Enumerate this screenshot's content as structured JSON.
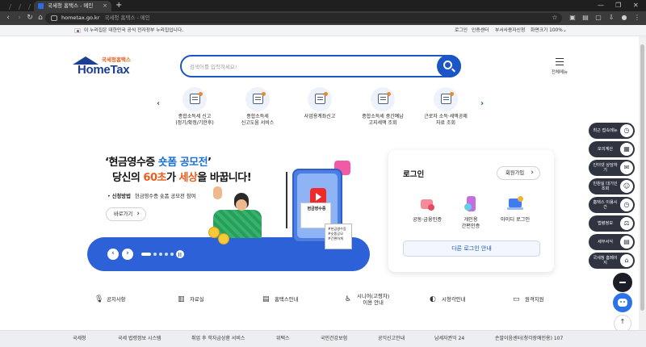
{
  "browser": {
    "tab_title": "국세청 홈택스 - 메인",
    "tab_close": "×",
    "new_tab": "+",
    "url_host": "hometax.go.kr",
    "url_title": "국세청 홈택스 - 메인",
    "window_min": "—",
    "window_max": "❐",
    "window_close": "✕"
  },
  "govbar": {
    "notice": "이 누리집은 대한민국 공식 전자정부 누리집입니다.",
    "links": [
      "로그인",
      "인증센터",
      "부서사용자신청"
    ],
    "zoom": "화면크기 100%"
  },
  "header": {
    "logo_sub": "국세청홈택스",
    "logo_main": "HomeTax",
    "search_placeholder": "검색어를 입력하세요!",
    "all_menu_label": "전체메뉴"
  },
  "quick_menu": [
    {
      "line1": "종합소득세 신고",
      "line2": "(정기/확정/기한후)"
    },
    {
      "line1": "종합소득세",
      "line2": "신고도움 서비스"
    },
    {
      "line1": "사업용계좌신고",
      "line2": ""
    },
    {
      "line1": "종합소득세 중간예납",
      "line2": "고지세액 조회"
    },
    {
      "line1": "근로자 소득·세액공제",
      "line2": "자료 조회"
    }
  ],
  "banner": {
    "headline_open": "‘현금영수증 ",
    "headline_accent": "숏폼 공모전",
    "headline_close": "’",
    "line2_pre": "당신의 ",
    "line2_accent1": "60초",
    "line2_mid": "가 ",
    "line2_accent2": "세상",
    "line2_post": "을 바꿉니다!",
    "info_key": "신청방법",
    "info_value": "현금영수증 숏폼 공모전 참여",
    "shortcut_label": "바로가기",
    "phone_card": "현금영수증",
    "tags": [
      "#현금영수증",
      "#숏폼공모",
      "#간편하게"
    ]
  },
  "login": {
    "title": "로그인",
    "join_label": "회원가입",
    "options": [
      {
        "line1": "공동·금융인증",
        "line2": ""
      },
      {
        "line1": "개인용",
        "line2": "간편인증"
      },
      {
        "line1": "아이디 로그인",
        "line2": ""
      }
    ],
    "other_login": "다른 로그인 안내"
  },
  "float_menu": [
    {
      "label": "최근 접속메뉴",
      "icon": "clock-icon"
    },
    {
      "label": "모의계산",
      "icon": "calculator-icon"
    },
    {
      "label": "인터넷 상담하기",
      "icon": "chat-icon"
    },
    {
      "label": "민원실 대기인 조회",
      "icon": "person-icon"
    },
    {
      "label": "홈택스 이용시간",
      "icon": "clock-icon"
    },
    {
      "label": "법령정보",
      "icon": "law-icon"
    },
    {
      "label": "세무서식",
      "icon": "form-icon"
    },
    {
      "label": "국세청 홈페이지",
      "icon": "home-icon"
    }
  ],
  "shortcuts": [
    {
      "line1": "공지사항",
      "line2": ""
    },
    {
      "line1": "자료실",
      "line2": ""
    },
    {
      "line1": "홈택스안내",
      "line2": ""
    },
    {
      "line1": "시니어(고령자)",
      "line2": "이용 안내"
    },
    {
      "line1": "시청각안내",
      "line2": ""
    },
    {
      "line1": "원격지원",
      "line2": ""
    }
  ],
  "footer_links": [
    "국세청",
    "국세 법령정보 시스템",
    "취업 후 학자금상환 서비스",
    "위택스",
    "국민건강보험",
    "공익신고안내",
    "납세자권익 24",
    "손말이음센터(청각장애인용) 107"
  ],
  "colors": {
    "brand_blue": "#1c56c6",
    "accent_orange": "#ee5d1d",
    "dark_menu": "#2f3440"
  }
}
